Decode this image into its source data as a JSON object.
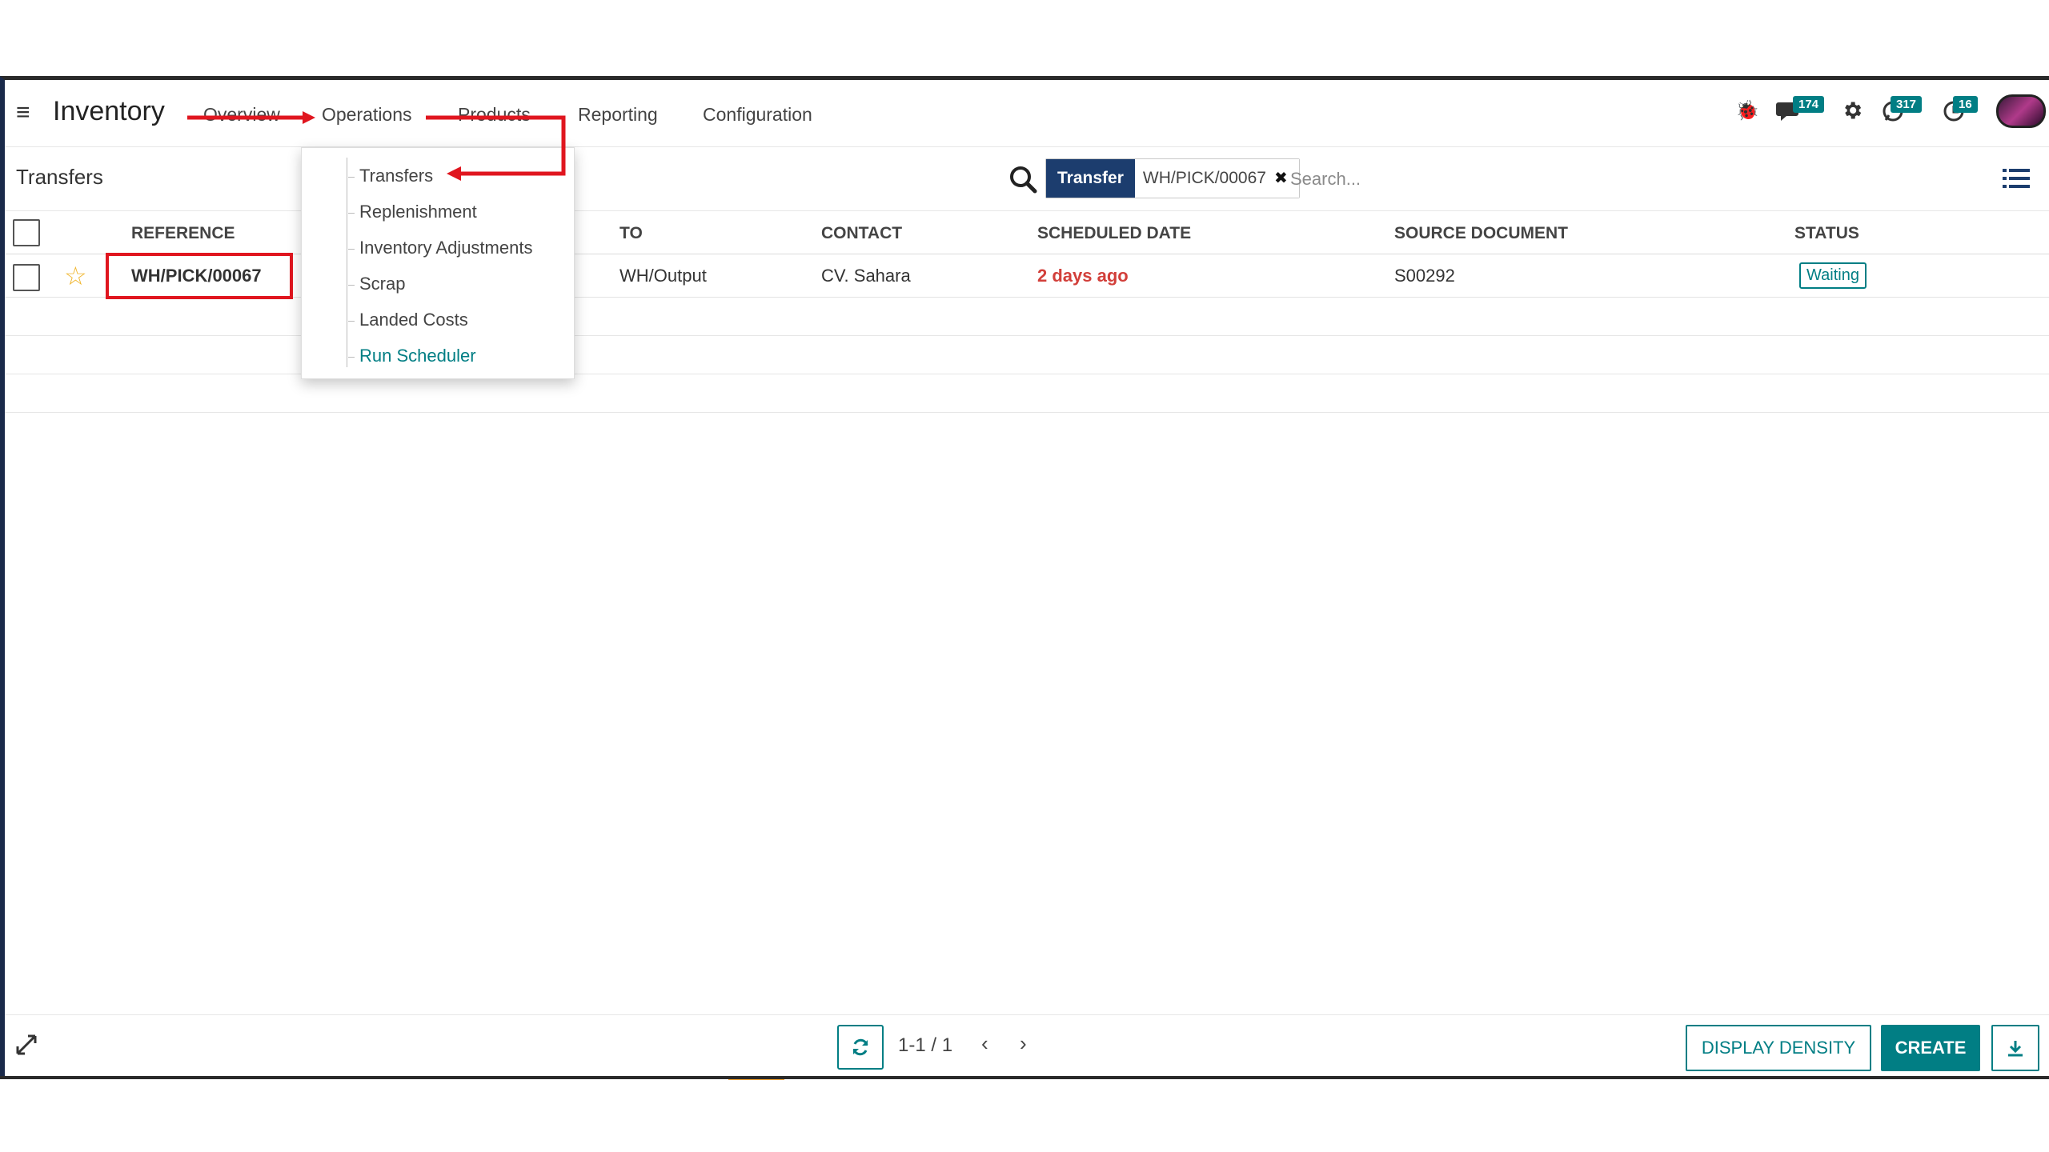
{
  "app": {
    "title": "Inventory",
    "menu": [
      "Overview",
      "Operations",
      "Products",
      "Reporting",
      "Configuration"
    ]
  },
  "systray": {
    "debug_icon": "bug-icon",
    "messages_badge": "174",
    "activities_badge": "317",
    "clock_badge": "16"
  },
  "breadcrumb": "Transfers",
  "search": {
    "facet_label": "Transfer",
    "facet_value": "WH/PICK/00067",
    "placeholder": "Search..."
  },
  "dropdown": {
    "items": [
      "Transfers",
      "Replenishment",
      "Inventory Adjustments",
      "Scrap",
      "Landed Costs",
      "Run Scheduler"
    ]
  },
  "table": {
    "headers": [
      "REFERENCE",
      "TO",
      "CONTACT",
      "SCHEDULED DATE",
      "SOURCE DOCUMENT",
      "STATUS"
    ],
    "rows": [
      {
        "reference": "WH/PICK/00067",
        "to": "WH/Output",
        "contact": "CV. Sahara",
        "scheduled_date": "2 days ago",
        "source_document": "S00292",
        "status": "Waiting"
      }
    ]
  },
  "pager": "1-1 / 1",
  "buttons": {
    "display_density": "DISPLAY DENSITY",
    "create": "CREATE"
  },
  "colors": {
    "accent": "#017e84",
    "facet": "#1c3d6e",
    "annotation": "#e0161f",
    "overdue": "#d23f3a"
  }
}
